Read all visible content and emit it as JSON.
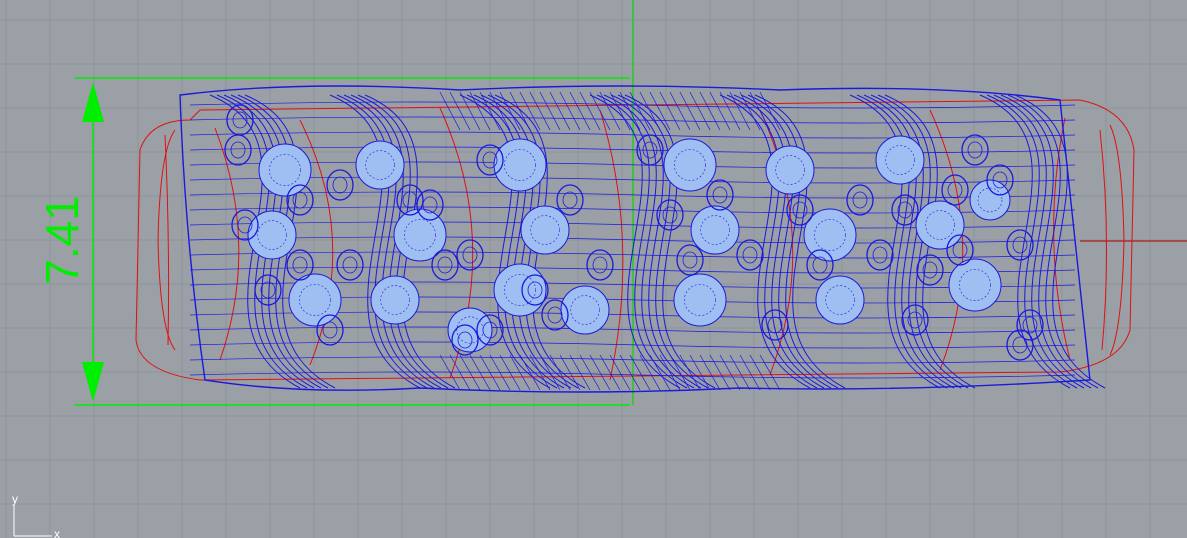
{
  "viewport": {
    "dimension_value": "7.41",
    "axis_labels": {
      "y": "y",
      "x": "x"
    },
    "colors": {
      "background": "#9ba0a6",
      "grid": "#8f959b",
      "dimension": "#00ee00",
      "wire_blue": "#1a1adc",
      "wire_red": "#e01010",
      "gem_fill": "#9fbff2",
      "axis_origin": "#22cc22",
      "axis_x": "#aa3333"
    }
  }
}
